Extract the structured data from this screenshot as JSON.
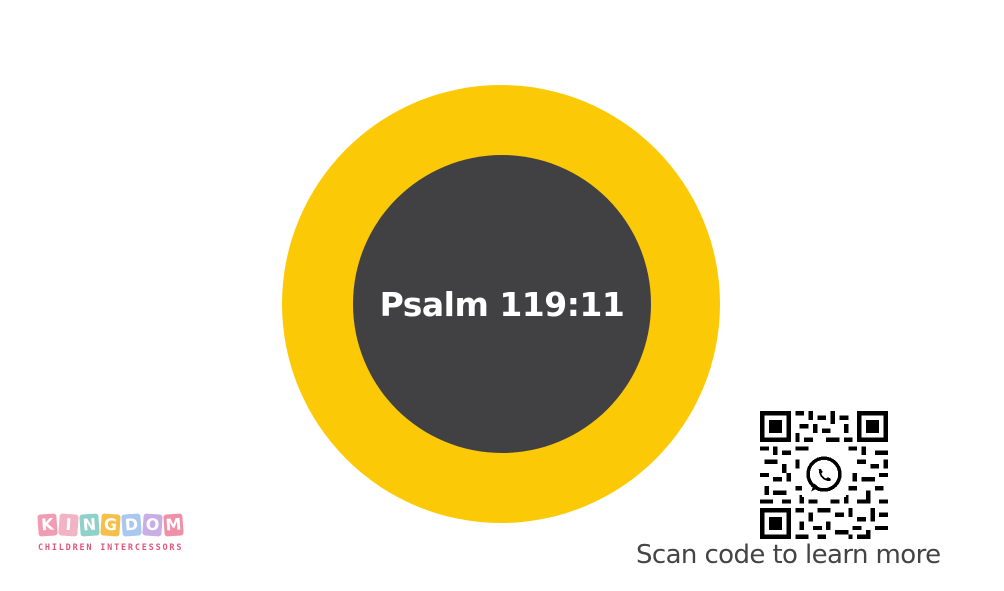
{
  "center": {
    "verse_ref": "Psalm 119:11"
  },
  "qr": {
    "caption": "Scan code to learn more",
    "icon": "whatsapp-icon"
  },
  "logo": {
    "letters": [
      {
        "char": "K",
        "color": "#f29cb4"
      },
      {
        "char": "I",
        "color": "#f2b3c3"
      },
      {
        "char": "N",
        "color": "#8fd0c8"
      },
      {
        "char": "G",
        "color": "#f5c04a"
      },
      {
        "char": "D",
        "color": "#a8c8ef"
      },
      {
        "char": "O",
        "color": "#c9aee6"
      },
      {
        "char": "M",
        "color": "#ef8fa8"
      }
    ],
    "tagline": "CHILDREN INTERCESSORS"
  },
  "colors": {
    "ring": "#fcc907",
    "disc": "#414042",
    "caption": "#444444"
  }
}
